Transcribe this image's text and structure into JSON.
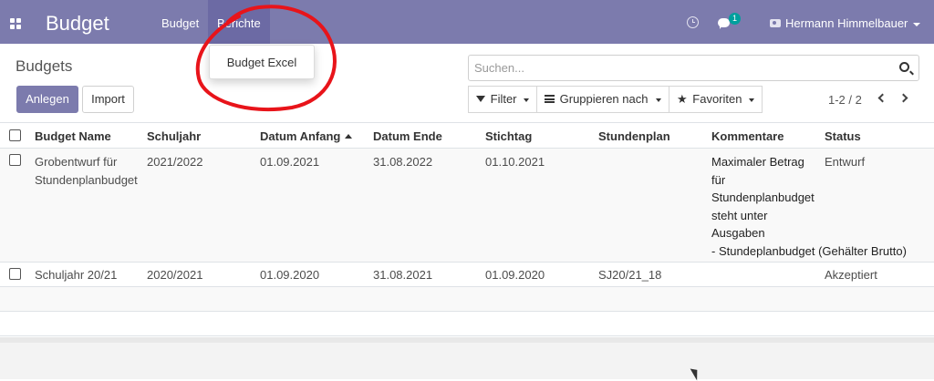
{
  "topbar": {
    "app_title": "Budget",
    "menu": [
      "Budget",
      "Berichte"
    ],
    "chat_badge": "1",
    "user_name": "Hermann Himmelbauer",
    "color": "#7c7bad"
  },
  "berichte_dropdown": {
    "items": [
      "Budget Excel"
    ]
  },
  "control_panel": {
    "breadcrumb": "Budgets",
    "create_label": "Anlegen",
    "import_label": "Import",
    "search_placeholder": "Suchen...",
    "filter_label": "Filter",
    "groupby_label": "Gruppieren nach",
    "favorites_label": "Favoriten",
    "pager": "1-2 / 2"
  },
  "table": {
    "headers": [
      "Budget Name",
      "Schuljahr",
      "Datum Anfang",
      "Datum Ende",
      "Stichtag",
      "Stundenplan",
      "Kommentare",
      "Status"
    ],
    "sorted_column": "Datum Anfang",
    "rows": [
      {
        "name_lines": [
          "Grobentwurf für",
          "Stundenplanbudget"
        ],
        "schuljahr": "2021/2022",
        "datum_anfang": "01.09.2021",
        "datum_ende": "31.08.2022",
        "stichtag": "01.10.2021",
        "stundenplan": "",
        "kommentare_lines": [
          "Maximaler Betrag",
          "für",
          "Stundenplanbudget",
          "steht unter",
          "Ausgaben",
          "- Stundeplanbudget (Gehälter Brutto)"
        ],
        "status": "Entwurf"
      },
      {
        "name_lines": [
          "Schuljahr 20/21"
        ],
        "schuljahr": "2020/2021",
        "datum_anfang": "01.09.2020",
        "datum_ende": "31.08.2021",
        "stichtag": "01.09.2020",
        "stundenplan": "SJ20/21_18",
        "kommentare_lines": [],
        "status": "Akzeptiert"
      }
    ]
  },
  "annotation": {
    "shape": "hand-drawn-circle",
    "color": "#e8141a"
  }
}
